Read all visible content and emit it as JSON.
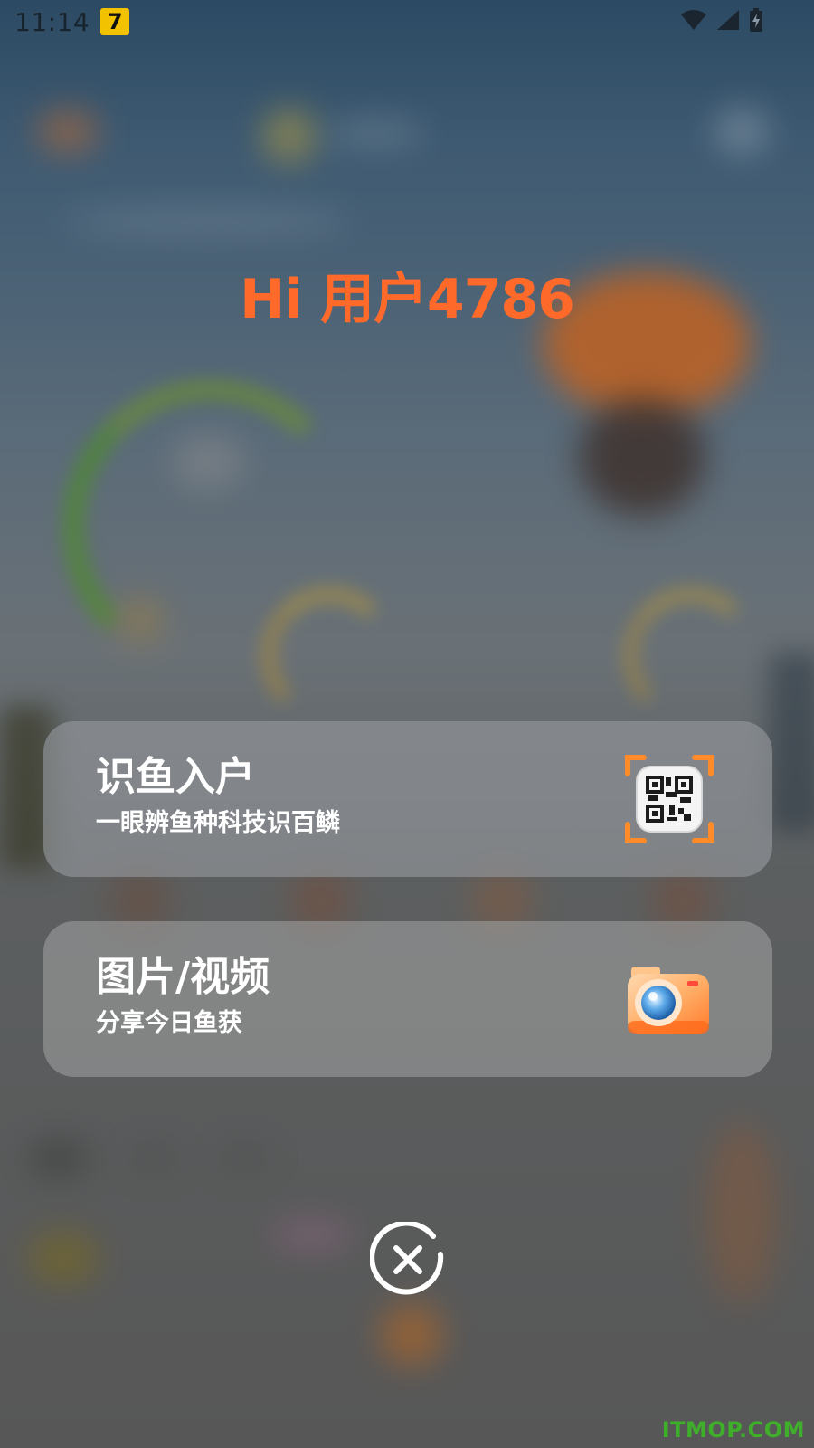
{
  "status_bar": {
    "time": "11:14",
    "app_badge": "7",
    "icons": [
      "wifi-icon",
      "signal-icon",
      "battery-charging-icon"
    ]
  },
  "greeting": "Hi 用户4786",
  "actions": [
    {
      "title": "识鱼入户",
      "subtitle": "一眼辨鱼种科技识百鳞",
      "icon": "qr-scan-icon"
    },
    {
      "title": "图片/视频",
      "subtitle": "分享今日鱼获",
      "icon": "camera-icon"
    }
  ],
  "close_icon": "close-circle-icon",
  "watermark": "ITMOP.COM",
  "colors": {
    "greeting": "#ff6a2a",
    "card_text": "#ffffff",
    "scan_accent": "#ff8a2a",
    "watermark": "#3fae2a"
  }
}
